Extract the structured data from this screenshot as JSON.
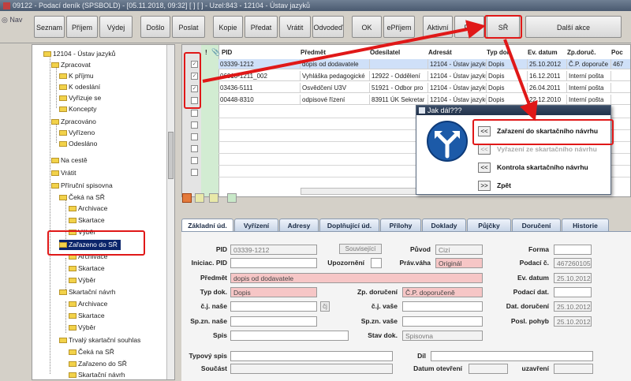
{
  "window": {
    "title": "09122 - Podací deník (SPSBOLD) - [05.11.2018, 09:32] [ ] [ ] - Uzel:843 - 12104 - Ústav jazyků"
  },
  "nav": {
    "label": "Nav"
  },
  "toolbar": {
    "buttons": [
      "Seznam",
      "Příjem",
      "Výdej",
      "Došlo",
      "Poslat",
      "Kopie",
      "Předat",
      "Vrátit",
      "Odvodeď",
      "OK",
      "ePříjem",
      "Aktivní",
      "Půj",
      "SŘ",
      "Další akce"
    ]
  },
  "tree": {
    "items": [
      {
        "label": "12104 - Ústav jazyků"
      },
      {
        "label": "Zpracovat"
      },
      {
        "label": "K příjmu"
      },
      {
        "label": "K odeslání"
      },
      {
        "label": "Vyřizuje se"
      },
      {
        "label": "Koncepty"
      },
      {
        "label": "Zpracováno"
      },
      {
        "label": "Vyřízeno"
      },
      {
        "label": "Odesláno"
      },
      {
        "label": "Na cestě"
      },
      {
        "label": "Vrátit"
      },
      {
        "label": "Příruční spisovna"
      },
      {
        "label": "Čeká na SŘ"
      },
      {
        "label": "Archivace"
      },
      {
        "label": "Skartace"
      },
      {
        "label": "Výběr"
      },
      {
        "label": "Zařazeno do SŘ"
      },
      {
        "label": "Archivace"
      },
      {
        "label": "Skartace"
      },
      {
        "label": "Výběr"
      },
      {
        "label": "Skartační návrh"
      },
      {
        "label": "Archivace"
      },
      {
        "label": "Skartace"
      },
      {
        "label": "Výběr"
      },
      {
        "label": "Trvalý skartační souhlas"
      },
      {
        "label": "Čeká na SŘ"
      },
      {
        "label": "Zařazeno do SŘ"
      },
      {
        "label": "Skartační návrh"
      }
    ]
  },
  "grid": {
    "headers": [
      "!",
      "PID",
      "Předmět",
      "Odesílatel",
      "Adresát",
      "Typ dok",
      "Ev. datum",
      "Zp.doruč.",
      "Poc"
    ],
    "rows": [
      {
        "pid": "03339-1212",
        "predmet": "dopis od dodavatele",
        "odesilatel": "",
        "adresat": "12104 - Ústav jazyků",
        "typ": "Dopis",
        "datum": "25.10.2012",
        "zp": "Č.P. doporuče",
        "poc": "467"
      },
      {
        "pid": "06010-1211_002",
        "predmet": "Vyhláška pedagogické",
        "odesilatel": "12922 - Oddělení",
        "adresat": "12104 - Ústav jazyků",
        "typ": "Dopis",
        "datum": "16.12.2011",
        "zp": "Interní pošta",
        "poc": ""
      },
      {
        "pid": "03436-5111",
        "predmet": "Osvědčení U3V",
        "odesilatel": "51921 - Odbor pro",
        "adresat": "12104 - Ústav jazyků",
        "typ": "Dopis",
        "datum": "26.04.2011",
        "zp": "Interní pošta",
        "poc": ""
      },
      {
        "pid": "00448-8310",
        "predmet": "odpisové řízení",
        "odesilatel": "83911 ÚK Sekretar",
        "adresat": "12104 - Ústav jazyků",
        "typ": "Dopis",
        "datum": "22.12.2010",
        "zp": "Interní pošta",
        "poc": ""
      }
    ]
  },
  "popup": {
    "title": "Jak dál???",
    "options": [
      {
        "btn": "<<",
        "label": "Zařazení do skartačního návrhu",
        "enabled": true
      },
      {
        "btn": "<<",
        "label": "Vyřazení ze skartačního návrhu",
        "enabled": false
      },
      {
        "btn": "<<",
        "label": "Kontrola skartačního návrhu",
        "enabled": true
      },
      {
        "btn": ">>",
        "label": "Zpět",
        "enabled": true
      }
    ]
  },
  "tabs": [
    "Základní úd.",
    "Vyřízení",
    "Adresy",
    "Doplňující úd.",
    "Přílohy",
    "Doklady",
    "Půjčky",
    "Doručení",
    "Historie"
  ],
  "form": {
    "pid_label": "PID",
    "pid_value": "03339-1212",
    "souvisejici": "Související",
    "puvod_label": "Původ",
    "puvod_value": "Cizí",
    "forma_label": "Forma",
    "forma_value": "",
    "iniciac_label": "Iniciac. PID",
    "iniciac_value": "",
    "upozorneni_label": "Upozornění",
    "prav_label": "Práv.váha",
    "prav_value": "Originál",
    "podaci_label": "Podací č.",
    "podaci_value": "467260105",
    "predmet_label": "Předmět",
    "predmet_value": "dopis od dodavatele",
    "evdatum_label": "Ev. datum",
    "evdatum_value": "25.10.2012",
    "typdok_label": "Typ dok.",
    "typdok_value": "Dopis",
    "zpdoruc_label": "Zp. doručení",
    "zpdoruc_value": "Č.P. doporučeně",
    "podacidat_label": "Podací dat.",
    "podacidat_value": "",
    "cjnase_label": "č.j. naše",
    "cjnase_value": "",
    "cj_btn": "čj",
    "cjvase_label": "č.j. vaše",
    "cjvase_value": "",
    "datdoruc_label": "Dat. doručení",
    "datdoruc_value": "25.10.2012",
    "spznnase_label": "Sp.zn. naše",
    "spznnase_value": "",
    "spznvase_label": "Sp.zn. vaše",
    "spznvase_value": "",
    "posl_label": "Posl. pohyb",
    "posl_value": "25.10.2012",
    "spis_label": "Spis",
    "spis_value": "",
    "stav_label": "Stav dok.",
    "stav_value": "Spisovna",
    "typovy_label": "Typový spis",
    "typovy_value": "",
    "dil_label": "Díl",
    "dil_value": "",
    "soucast_label": "Součást",
    "soucast_value": "",
    "datumotev_label": "Datum otevření",
    "datumotev_value": "",
    "uzavreni_label": "uzavření",
    "uzavreni_value": ""
  },
  "colors": {
    "annotation": "#e01818",
    "popup_title": "#22324a",
    "pink_field": "#f6c6c6",
    "selected_row": "#cfe0f8"
  }
}
